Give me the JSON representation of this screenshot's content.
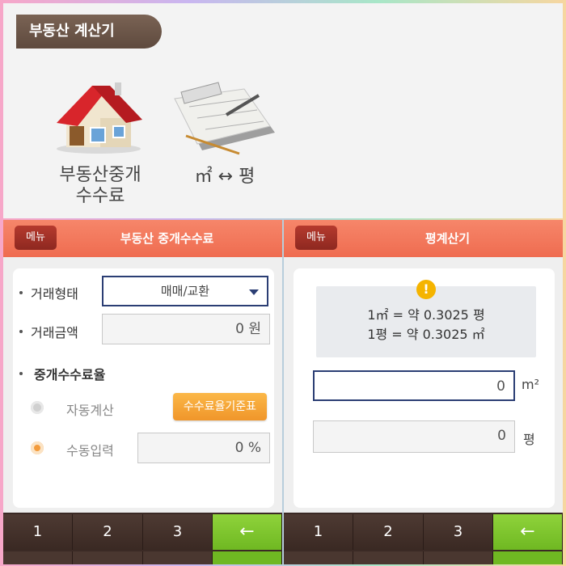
{
  "top": {
    "title": "부동산 계산기",
    "icons": [
      {
        "label_line1": "부동산중개",
        "label_line2": "수수료",
        "icon": "house-icon"
      },
      {
        "label_line1": "㎡ ↔ 평",
        "icon": "blueprint-icon"
      }
    ]
  },
  "left_app": {
    "menu": "메뉴",
    "title": "부동산 중개수수료",
    "trade_type_label": "거래형태",
    "trade_type_value": "매매/교환",
    "amount_label": "거래금액",
    "amount_value": "0 원",
    "rate_section": "중개수수료율",
    "auto_label": "자동계산",
    "std_button": "수수료율기준표",
    "manual_label": "수동입력",
    "manual_value": "0 %"
  },
  "right_app": {
    "menu": "메뉴",
    "title": "평계산기",
    "info_line1": "1㎡ = 약 0.3025 평",
    "info_line2": "1평 = 약 0.3025 ㎡",
    "info_icon": "!",
    "sqm_value": "0",
    "sqm_unit": "m²",
    "pyeong_value": "0",
    "pyeong_unit": "평"
  },
  "keypad": {
    "keys": [
      "1",
      "2",
      "3"
    ],
    "backspace": "←"
  },
  "colors": {
    "header": "#ef6c50",
    "menu": "#8e2820",
    "accent_orange": "#f0962a",
    "key_green": "#6fb822",
    "keypad": "#3b2a25",
    "title_tab": "#5e4a3e"
  }
}
